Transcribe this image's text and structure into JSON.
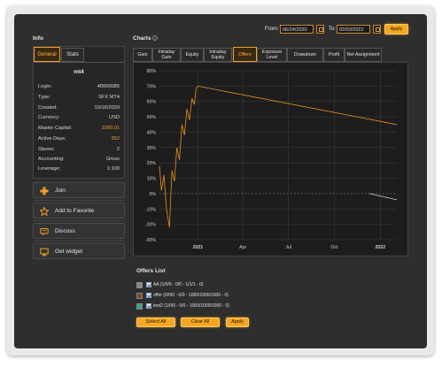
{
  "header": {
    "from_label": "From:",
    "from_value": "06/24/2020",
    "to_label": "To:",
    "to_value": "02/03/2022",
    "apply_label": "Apply"
  },
  "info": {
    "title": "Info",
    "tabs": [
      "General",
      "Stats"
    ],
    "account_name": "mt4",
    "rows": [
      {
        "label": "Login:",
        "value": "40000085"
      },
      {
        "label": "Type:",
        "value": "SFX MT4"
      },
      {
        "label": "Created:",
        "value": "10/16/2020"
      },
      {
        "label": "Currency:",
        "value": "USD"
      },
      {
        "label": "Master Capital:",
        "value": "1000.01"
      },
      {
        "label": "Active Days:",
        "value": "352"
      },
      {
        "label": "Slaves:",
        "value": "2"
      },
      {
        "label": "Accounting:",
        "value": "Gross"
      },
      {
        "label": "Leverage:",
        "value": "1:100"
      }
    ],
    "actions": [
      {
        "label": "Join",
        "icon": "plus-icon"
      },
      {
        "label": "Add to Favorite",
        "icon": "star-icon"
      },
      {
        "label": "Discuss",
        "icon": "chat-icon"
      },
      {
        "label": "Get widget",
        "icon": "monitor-icon"
      }
    ]
  },
  "charts": {
    "title": "Charts",
    "tabs": [
      "Gain",
      "Intraday Gain",
      "Equity",
      "Intraday Equity",
      "Offers",
      "Exposure Level",
      "Drawdown",
      "Profit",
      "Net Assignment"
    ],
    "active_tab": "Offers"
  },
  "chart_data": {
    "type": "line",
    "y_ticks": [
      "80%",
      "70%",
      "60%",
      "50%",
      "40%",
      "30%",
      "20%",
      "10%",
      "0%",
      "-10%",
      "-20%",
      "-30%"
    ],
    "ylim": [
      -30,
      80
    ],
    "x_ticks": [
      "2021",
      "Apr",
      "Jul",
      "Oct",
      "2022"
    ],
    "x_tick_positions": [
      "2021-01-01",
      "2021-04-01",
      "2021-07-01",
      "2021-10-01",
      "2022-01-01"
    ],
    "xlim": [
      "2020-10-16",
      "2022-02-03"
    ],
    "grid": true,
    "series": [
      {
        "color": "#e8921e",
        "x": [
          "2020-10-16",
          "2020-10-20",
          "2020-10-25",
          "2020-10-30",
          "2020-11-05",
          "2020-11-10",
          "2020-11-15",
          "2020-11-20",
          "2020-11-25",
          "2020-11-30",
          "2020-12-05",
          "2020-12-10",
          "2020-12-15",
          "2020-12-20",
          "2020-12-25",
          "2020-12-28",
          "2021-01-01",
          "2022-02-03"
        ],
        "y": [
          18,
          2,
          12,
          -10,
          -22,
          15,
          8,
          30,
          22,
          45,
          38,
          55,
          48,
          62,
          58,
          68,
          70,
          45
        ]
      },
      {
        "color": "#cccccc",
        "x": [
          "2021-12-10",
          "2022-02-03"
        ],
        "y": [
          0,
          -4
        ]
      }
    ]
  },
  "offers": {
    "title": "Offers List",
    "items": [
      {
        "label": "AA (1/0/0 - 0/0 - 1/1/1 - 0)",
        "color": "#8a8a8a"
      },
      {
        "label": "offer (0/0/0 - 0/0 - 1000/1000/1000 - 0)",
        "color": "#7a4a1e"
      },
      {
        "label": "test2 (1/0/0 - 0/0 - 1000/1000/1000 - 0)",
        "color": "#3aa090"
      }
    ],
    "select_all": "Select All",
    "clear_all": "Clear All",
    "apply": "Apply"
  }
}
